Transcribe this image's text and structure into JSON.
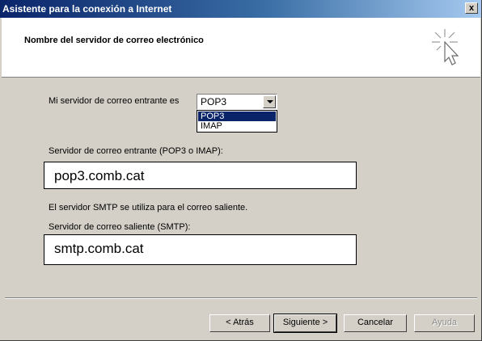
{
  "window": {
    "title": "Asistente para la conexión a Internet",
    "close_glyph": "x"
  },
  "header": {
    "title": "Nombre del servidor de correo electrónico",
    "icon": "wizard-pointer-icon"
  },
  "incoming_type": {
    "label": "Mi servidor de correo entrante es",
    "selected": "POP3",
    "options": [
      "POP3",
      "IMAP"
    ]
  },
  "incoming_server": {
    "label": "Servidor de correo entrante (POP3 o IMAP):",
    "value": "pop3.comb.cat"
  },
  "smtp_note": "El servidor SMTP se utiliza para el correo saliente.",
  "outgoing_server": {
    "label": "Servidor de correo saliente (SMTP):",
    "value": "smtp.comb.cat"
  },
  "buttons": {
    "back": "< Atrás",
    "next": "Siguiente >",
    "cancel": "Cancelar",
    "help": "Ayuda"
  },
  "colors": {
    "titlebar_start": "#0a246a",
    "titlebar_end": "#a6caf0",
    "dialog_face": "#d4d0c8",
    "selection": "#0a246a"
  }
}
